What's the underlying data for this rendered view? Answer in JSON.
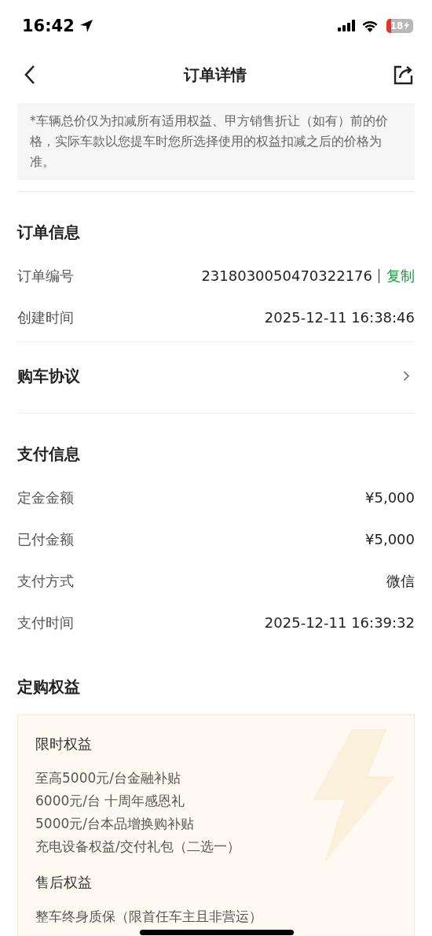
{
  "status_bar": {
    "time": "16:42",
    "battery": "18"
  },
  "nav": {
    "title": "订单详情"
  },
  "notice": "*车辆总价仅为扣减所有适用权益、甲方销售折让（如有）前的价格，实际车款以您提车时您所选择使用的权益扣减之后的价格为准。",
  "order_info": {
    "title": "订单信息",
    "rows": [
      {
        "label": "订单编号",
        "value": "2318030050470322176",
        "action": "复制"
      },
      {
        "label": "创建时间",
        "value": "2025-12-11 16:38:46"
      }
    ]
  },
  "agreement": {
    "label": "购车协议"
  },
  "payment_info": {
    "title": "支付信息",
    "rows": [
      {
        "label": "定金金额",
        "value": "¥5,000"
      },
      {
        "label": "已付金额",
        "value": "¥5,000"
      },
      {
        "label": "支付方式",
        "value": "微信"
      },
      {
        "label": "支付时间",
        "value": "2025-12-11 16:39:32"
      }
    ]
  },
  "benefits": {
    "title": "定购权益",
    "groups": [
      {
        "title": "限时权益",
        "items": [
          "至高5000元/台金融补贴",
          "6000元/台 十周年感恩礼",
          "5000元/台本品增换购补贴",
          "充电设备权益/交付礼包（二选一）"
        ]
      },
      {
        "title": "售后权益",
        "items": [
          "整车终身质保（限首任车主且非营运）"
        ]
      }
    ]
  }
}
